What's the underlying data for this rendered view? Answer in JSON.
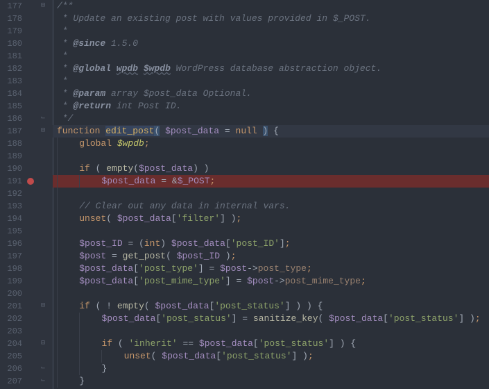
{
  "lines": [
    {
      "num": 177,
      "fold": "down",
      "segs": [
        [
          "c-comment",
          "/**"
        ]
      ]
    },
    {
      "num": 178,
      "segs": [
        [
          "c-comment",
          " * Update an existing post with values provided in $_POST."
        ]
      ]
    },
    {
      "num": 179,
      "segs": [
        [
          "c-comment",
          " *"
        ]
      ]
    },
    {
      "num": 180,
      "segs": [
        [
          "c-comment",
          " * "
        ],
        [
          "c-doctag",
          "@since"
        ],
        [
          "c-comment",
          " 1.5.0"
        ]
      ]
    },
    {
      "num": 181,
      "segs": [
        [
          "c-comment",
          " *"
        ]
      ]
    },
    {
      "num": 182,
      "segs": [
        [
          "c-comment",
          " * "
        ],
        [
          "c-doctag",
          "@global"
        ],
        [
          "c-comment",
          " "
        ],
        [
          "c-doctag-u",
          "wpdb"
        ],
        [
          "c-comment",
          " "
        ],
        [
          "c-doctag-u",
          "$wpdb"
        ],
        [
          "c-comment",
          " WordPress database abstraction object."
        ]
      ]
    },
    {
      "num": 183,
      "segs": [
        [
          "c-comment",
          " *"
        ]
      ]
    },
    {
      "num": 184,
      "segs": [
        [
          "c-comment",
          " * "
        ],
        [
          "c-doctag",
          "@param"
        ],
        [
          "c-comment",
          " array $post_data Optional."
        ]
      ]
    },
    {
      "num": 185,
      "segs": [
        [
          "c-comment",
          " * "
        ],
        [
          "c-doctag",
          "@return"
        ],
        [
          "c-comment",
          " int Post ID."
        ]
      ]
    },
    {
      "num": 186,
      "fold": "up",
      "segs": [
        [
          "c-comment",
          " */"
        ]
      ]
    },
    {
      "num": 187,
      "fold": "down",
      "hl": true,
      "segs": [
        [
          "c-keyword",
          "function "
        ],
        [
          "c-funcname",
          "edit_post"
        ],
        [
          "c-paren-hl",
          "("
        ],
        [
          "c-text",
          " "
        ],
        [
          "c-var",
          "$post_data"
        ],
        [
          "c-text",
          " "
        ],
        [
          "c-op",
          "="
        ],
        [
          "c-text",
          " "
        ],
        [
          "c-keyword",
          "null"
        ],
        [
          "c-text",
          " "
        ],
        [
          "c-paren-hl",
          ")"
        ],
        [
          "c-text",
          " {"
        ]
      ]
    },
    {
      "num": 188,
      "indent": 1,
      "segs": [
        [
          "c-keyword",
          "global "
        ],
        [
          "c-global",
          "$wpdb"
        ],
        [
          "c-punct",
          ";"
        ]
      ]
    },
    {
      "num": 189,
      "indent": 1,
      "segs": []
    },
    {
      "num": 190,
      "indent": 1,
      "segs": [
        [
          "c-keyword",
          "if"
        ],
        [
          "c-text",
          " ( "
        ],
        [
          "c-func",
          "empty"
        ],
        [
          "c-text",
          "("
        ],
        [
          "c-var",
          "$post_data"
        ],
        [
          "c-text",
          ") )"
        ]
      ]
    },
    {
      "num": 191,
      "bp": true,
      "red": true,
      "indent": 2,
      "segs": [
        [
          "c-var",
          "$post_data"
        ],
        [
          "c-text",
          " "
        ],
        [
          "c-op",
          "="
        ],
        [
          "c-text",
          " &"
        ],
        [
          "c-var",
          "$_POST"
        ],
        [
          "c-punct",
          ";"
        ]
      ]
    },
    {
      "num": 192,
      "indent": 1,
      "segs": []
    },
    {
      "num": 193,
      "indent": 1,
      "segs": [
        [
          "c-comment",
          "// Clear out any data in internal vars."
        ]
      ]
    },
    {
      "num": 194,
      "indent": 1,
      "segs": [
        [
          "c-keyword",
          "unset"
        ],
        [
          "c-text",
          "( "
        ],
        [
          "c-var",
          "$post_data"
        ],
        [
          "c-text",
          "["
        ],
        [
          "c-string",
          "'filter'"
        ],
        [
          "c-text",
          "] )"
        ],
        [
          "c-punct",
          ";"
        ]
      ]
    },
    {
      "num": 195,
      "indent": 1,
      "segs": []
    },
    {
      "num": 196,
      "indent": 1,
      "segs": [
        [
          "c-var",
          "$post_ID"
        ],
        [
          "c-text",
          " "
        ],
        [
          "c-op",
          "="
        ],
        [
          "c-text",
          " ("
        ],
        [
          "c-keyword",
          "int"
        ],
        [
          "c-text",
          ") "
        ],
        [
          "c-var",
          "$post_data"
        ],
        [
          "c-text",
          "["
        ],
        [
          "c-string",
          "'post_ID'"
        ],
        [
          "c-text",
          "]"
        ],
        [
          "c-punct",
          ";"
        ]
      ]
    },
    {
      "num": 197,
      "indent": 1,
      "segs": [
        [
          "c-var",
          "$post"
        ],
        [
          "c-text",
          " "
        ],
        [
          "c-op",
          "="
        ],
        [
          "c-text",
          " "
        ],
        [
          "c-func",
          "get_post"
        ],
        [
          "c-text",
          "( "
        ],
        [
          "c-var",
          "$post_ID"
        ],
        [
          "c-text",
          " )"
        ],
        [
          "c-punct",
          ";"
        ]
      ]
    },
    {
      "num": 198,
      "indent": 1,
      "segs": [
        [
          "c-var",
          "$post_data"
        ],
        [
          "c-text",
          "["
        ],
        [
          "c-string",
          "'post_type'"
        ],
        [
          "c-text",
          "] "
        ],
        [
          "c-op",
          "="
        ],
        [
          "c-text",
          " "
        ],
        [
          "c-var",
          "$post"
        ],
        [
          "c-op",
          "->"
        ],
        [
          "c-member",
          "post_type"
        ],
        [
          "c-punct",
          ";"
        ]
      ]
    },
    {
      "num": 199,
      "indent": 1,
      "segs": [
        [
          "c-var",
          "$post_data"
        ],
        [
          "c-text",
          "["
        ],
        [
          "c-string",
          "'post_mime_type'"
        ],
        [
          "c-text",
          "] "
        ],
        [
          "c-op",
          "="
        ],
        [
          "c-text",
          " "
        ],
        [
          "c-var",
          "$post"
        ],
        [
          "c-op",
          "->"
        ],
        [
          "c-member",
          "post_mime_type"
        ],
        [
          "c-punct",
          ";"
        ]
      ]
    },
    {
      "num": 200,
      "indent": 1,
      "segs": []
    },
    {
      "num": 201,
      "fold": "down",
      "indent": 1,
      "segs": [
        [
          "c-keyword",
          "if"
        ],
        [
          "c-text",
          " ( "
        ],
        [
          "c-op",
          "!"
        ],
        [
          "c-text",
          " "
        ],
        [
          "c-func",
          "empty"
        ],
        [
          "c-text",
          "( "
        ],
        [
          "c-var",
          "$post_data"
        ],
        [
          "c-text",
          "["
        ],
        [
          "c-string",
          "'post_status'"
        ],
        [
          "c-text",
          "] ) ) {"
        ]
      ]
    },
    {
      "num": 202,
      "indent": 2,
      "segs": [
        [
          "c-var",
          "$post_data"
        ],
        [
          "c-text",
          "["
        ],
        [
          "c-string",
          "'post_status'"
        ],
        [
          "c-text",
          "] "
        ],
        [
          "c-op",
          "="
        ],
        [
          "c-text",
          " "
        ],
        [
          "c-func",
          "sanitize_key"
        ],
        [
          "c-text",
          "( "
        ],
        [
          "c-var",
          "$post_data"
        ],
        [
          "c-text",
          "["
        ],
        [
          "c-string",
          "'post_status'"
        ],
        [
          "c-text",
          "] )"
        ],
        [
          "c-punct",
          ";"
        ]
      ]
    },
    {
      "num": 203,
      "indent": 2,
      "segs": []
    },
    {
      "num": 204,
      "fold": "down",
      "indent": 2,
      "segs": [
        [
          "c-keyword",
          "if"
        ],
        [
          "c-text",
          " ( "
        ],
        [
          "c-string",
          "'inherit'"
        ],
        [
          "c-text",
          " "
        ],
        [
          "c-op",
          "=="
        ],
        [
          "c-text",
          " "
        ],
        [
          "c-var",
          "$post_data"
        ],
        [
          "c-text",
          "["
        ],
        [
          "c-string",
          "'post_status'"
        ],
        [
          "c-text",
          "] ) {"
        ]
      ]
    },
    {
      "num": 205,
      "indent": 3,
      "segs": [
        [
          "c-keyword",
          "unset"
        ],
        [
          "c-text",
          "( "
        ],
        [
          "c-var",
          "$post_data"
        ],
        [
          "c-text",
          "["
        ],
        [
          "c-string",
          "'post_status'"
        ],
        [
          "c-text",
          "] )"
        ],
        [
          "c-punct",
          ";"
        ]
      ]
    },
    {
      "num": 206,
      "fold": "up",
      "indent": 2,
      "segs": [
        [
          "c-text",
          "}"
        ]
      ]
    },
    {
      "num": 207,
      "fold": "up",
      "indent": 1,
      "segs": [
        [
          "c-text",
          "}"
        ]
      ]
    }
  ]
}
